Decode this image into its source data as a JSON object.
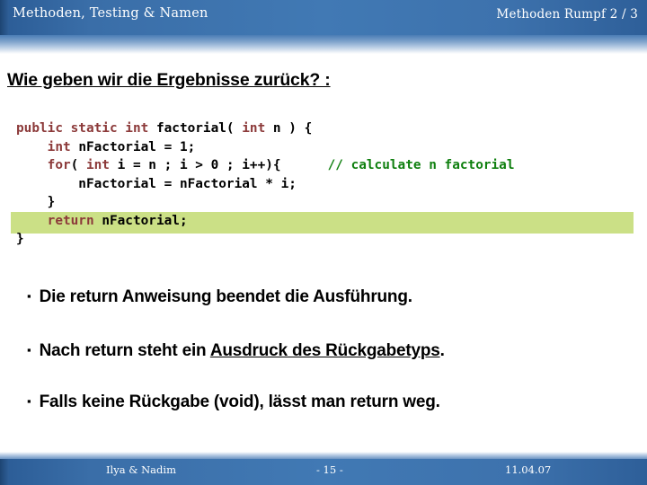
{
  "header": {
    "left_title": "Methoden, Testing & Namen",
    "right_title": "Methoden Rumpf 2 / 3",
    "band_color": "#3a6ea8"
  },
  "slide": {
    "title": "Wie geben wir die Ergebnisse zurück? :"
  },
  "code": {
    "highlight_color": "#cbe086",
    "keyword_color": "#8c3a3a",
    "comment_color": "#108010",
    "lines": [
      {
        "id": "line-1",
        "highlighted": false,
        "tokens": [
          {
            "text": "public static int ",
            "kind": "keyword"
          },
          {
            "text": "factorial( ",
            "kind": "plain"
          },
          {
            "text": "int ",
            "kind": "keyword"
          },
          {
            "text": "n ) {",
            "kind": "plain"
          }
        ]
      },
      {
        "id": "line-2",
        "highlighted": false,
        "tokens": [
          {
            "text": "    int ",
            "kind": "keyword"
          },
          {
            "text": "nFactorial = 1;",
            "kind": "plain"
          }
        ]
      },
      {
        "id": "line-3",
        "highlighted": false,
        "tokens": [
          {
            "text": "    for",
            "kind": "keyword"
          },
          {
            "text": "( ",
            "kind": "plain"
          },
          {
            "text": "int ",
            "kind": "keyword"
          },
          {
            "text": "i = n ; i > 0 ; i++){      ",
            "kind": "plain"
          },
          {
            "text": "// calculate n factorial",
            "kind": "comment"
          }
        ]
      },
      {
        "id": "line-4",
        "highlighted": false,
        "tokens": [
          {
            "text": "        nFactorial = nFactorial * i;",
            "kind": "plain"
          }
        ]
      },
      {
        "id": "line-5",
        "highlighted": false,
        "tokens": [
          {
            "text": "    }",
            "kind": "plain"
          }
        ]
      },
      {
        "id": "line-6",
        "highlighted": true,
        "tokens": [
          {
            "text": "    return ",
            "kind": "keyword"
          },
          {
            "text": "nFactorial;",
            "kind": "plain"
          }
        ]
      },
      {
        "id": "line-7",
        "highlighted": false,
        "tokens": [
          {
            "text": "}",
            "kind": "plain"
          }
        ]
      }
    ]
  },
  "bullets": {
    "marker": "▪",
    "items": [
      {
        "id": "bullet-1",
        "prefix": "Die return Anweisung beendet die Ausführung.",
        "underlined": "",
        "suffix": ""
      },
      {
        "id": "bullet-2",
        "prefix": "Nach return steht ein ",
        "underlined": "Ausdruck des Rückgabetyps",
        "suffix": "."
      },
      {
        "id": "bullet-3",
        "prefix": "Falls keine Rückgabe (void), lässt man return weg.",
        "underlined": "",
        "suffix": ""
      }
    ]
  },
  "footer": {
    "authors": "Ilya & Nadim",
    "page": "- 15 -",
    "date": "11.04.07"
  }
}
